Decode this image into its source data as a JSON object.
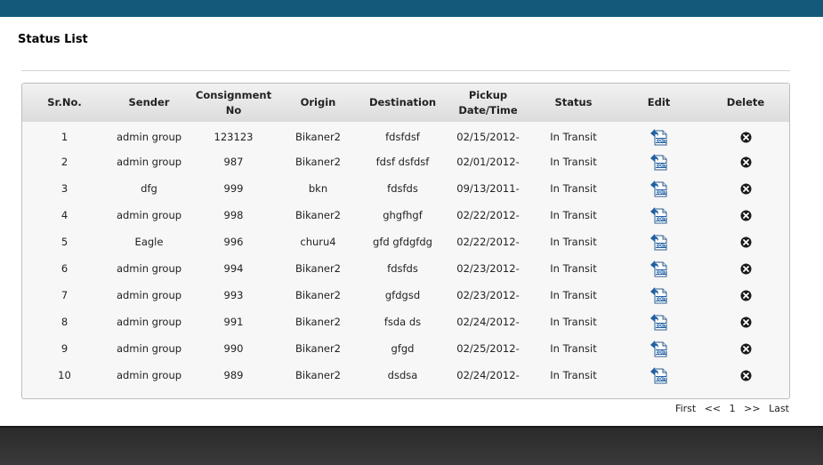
{
  "page_title": "Status List",
  "table": {
    "headers": {
      "sr_no": "Sr.No.",
      "sender": "Sender",
      "consignment_line1": "Consignment",
      "consignment_line2": "No",
      "origin": "Origin",
      "destination": "Destination",
      "pickup_line1": "Pickup",
      "pickup_line2": "Date/Time",
      "status": "Status",
      "edit": "Edit",
      "delete": "Delete"
    },
    "rows": [
      {
        "sr": "1",
        "sender": "admin group",
        "consignment": "123123",
        "origin": "Bikaner2",
        "destination": "fdsfdsf",
        "pickup": "02/15/2012-",
        "status": "In Transit"
      },
      {
        "sr": "2",
        "sender": "admin group",
        "consignment": "987",
        "origin": "Bikaner2",
        "destination": "fdsf dsfdsf",
        "pickup": "02/01/2012-",
        "status": "In Transit"
      },
      {
        "sr": "3",
        "sender": "dfg",
        "consignment": "999",
        "origin": "bkn",
        "destination": "fdsfds",
        "pickup": "09/13/2011-",
        "status": "In Transit"
      },
      {
        "sr": "4",
        "sender": "admin group",
        "consignment": "998",
        "origin": "Bikaner2",
        "destination": "ghgfhgf",
        "pickup": "02/22/2012-",
        "status": "In Transit"
      },
      {
        "sr": "5",
        "sender": "Eagle",
        "consignment": "996",
        "origin": "churu4",
        "destination": "gfd gfdgfdg",
        "pickup": "02/22/2012-",
        "status": "In Transit"
      },
      {
        "sr": "6",
        "sender": "admin group",
        "consignment": "994",
        "origin": "Bikaner2",
        "destination": "fdsfds",
        "pickup": "02/23/2012-",
        "status": "In Transit"
      },
      {
        "sr": "7",
        "sender": "admin group",
        "consignment": "993",
        "origin": "Bikaner2",
        "destination": "gfdgsd",
        "pickup": "02/23/2012-",
        "status": "In Transit"
      },
      {
        "sr": "8",
        "sender": "admin group",
        "consignment": "991",
        "origin": "Bikaner2",
        "destination": "fsda ds",
        "pickup": "02/24/2012-",
        "status": "In Transit"
      },
      {
        "sr": "9",
        "sender": "admin group",
        "consignment": "990",
        "origin": "Bikaner2",
        "destination": "gfgd",
        "pickup": "02/25/2012-",
        "status": "In Transit"
      },
      {
        "sr": "10",
        "sender": "admin group",
        "consignment": "989",
        "origin": "Bikaner2",
        "destination": "dsdsa",
        "pickup": "02/24/2012-",
        "status": "In Transit"
      }
    ],
    "edit_icon_text": "EDIT",
    "icons": {
      "edit": "edit-document-icon",
      "delete": "close-circle-icon"
    }
  },
  "pagination": {
    "first": "First",
    "prev": "<<",
    "current": "1",
    "next": ">>",
    "last": "Last"
  },
  "colors": {
    "topbar": "#14587a",
    "footer": "#333333"
  }
}
